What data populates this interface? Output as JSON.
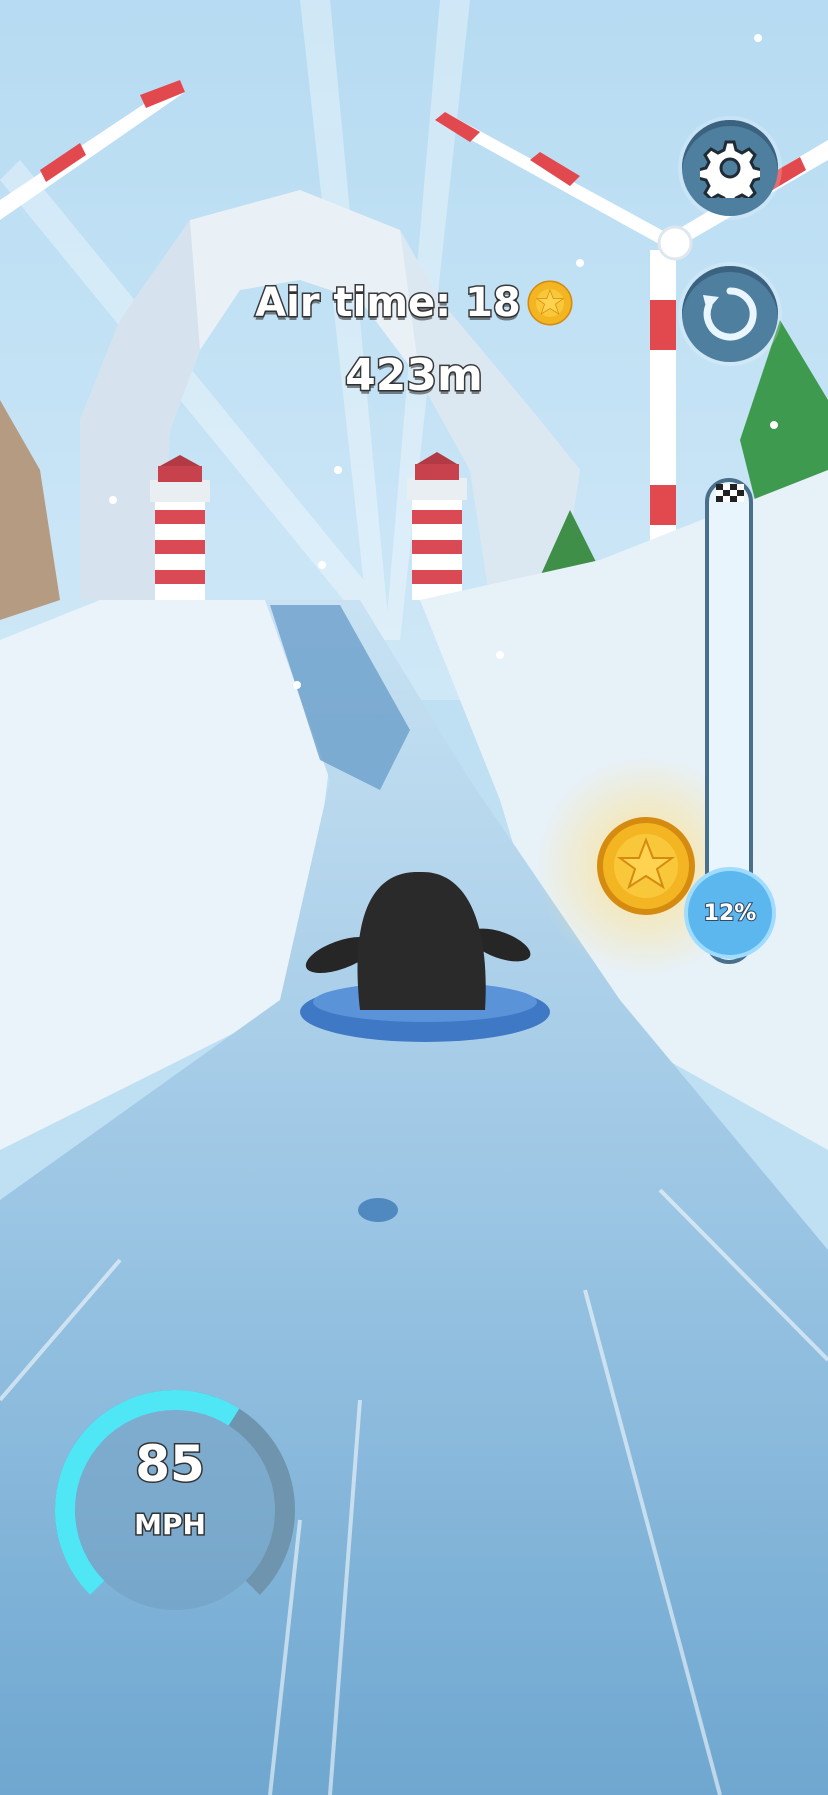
{
  "hud": {
    "airtime_label": "Air time: 18",
    "distance": "423m",
    "progress_percent_label": "12%",
    "progress_fraction": 0.12,
    "speed_value": "85",
    "speed_unit": "MPH",
    "speed_gauge_fraction": 0.62
  },
  "icons": {
    "settings": "gear-icon",
    "restart": "restart-icon",
    "coin": "star-coin-icon",
    "finish": "checkered-flag-icon"
  },
  "colors": {
    "sky": "#bfe0f3",
    "snow": "#eef6fb",
    "ice_track": "#7fb4da",
    "hud_button": "#4f7f9f",
    "coin_gold": "#f4b522",
    "gauge_active": "#4fe6f6",
    "gauge_track": "#6f94ad",
    "progress_badge": "#5bb7ee"
  }
}
